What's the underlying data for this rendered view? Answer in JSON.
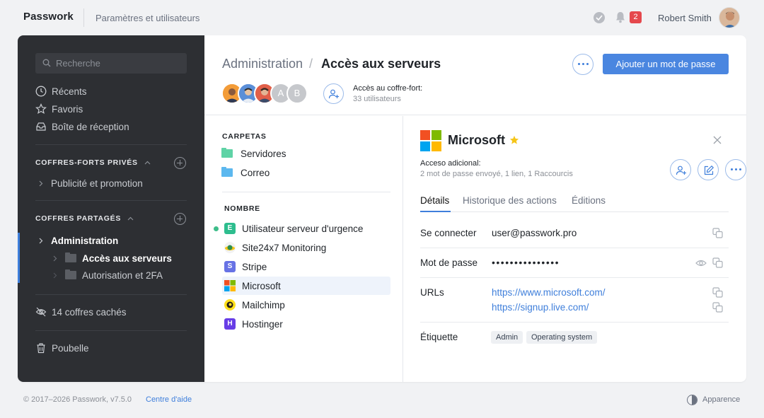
{
  "app": {
    "logo": "Passwork",
    "section": "Paramètres et utilisateurs",
    "notification_count": "2",
    "user_name": "Robert Smith"
  },
  "sidebar": {
    "search_placeholder": "Recherche",
    "nav": [
      {
        "label": "Récents",
        "icon": "clock-icon"
      },
      {
        "label": "Favoris",
        "icon": "star-icon"
      },
      {
        "label": "Boîte de réception",
        "icon": "inbox-icon"
      }
    ],
    "private_vaults": {
      "title": "COFFRES-FORTS PRIVÉS",
      "items": [
        {
          "label": "Publicité et promotion"
        }
      ]
    },
    "shared_vaults": {
      "title": "COFFRES PARTAGÉS",
      "items": [
        {
          "label": "Administration",
          "children": [
            {
              "label": "Accès aux serveurs"
            },
            {
              "label": "Autorisation et 2FA"
            }
          ]
        }
      ]
    },
    "hidden_vaults": "14 coffres cachés",
    "trash": "Poubelle"
  },
  "header": {
    "breadcrumb_parent": "Administration",
    "breadcrumb_separator": "/",
    "breadcrumb_current": "Accès aux serveurs",
    "add_password_button": "Ajouter un mot de passe",
    "member_letters": [
      "A",
      "B"
    ],
    "access_title": "Accès au coffre-fort:",
    "access_count": "33 utilisateurs"
  },
  "middle": {
    "folders_heading": "CARPETAS",
    "folders": [
      {
        "label": "Servidores",
        "color": "#5fd3a6"
      },
      {
        "label": "Correo",
        "color": "#5cb8ef"
      }
    ],
    "names_heading": "NOMBRE",
    "entries": [
      {
        "label": "Utilisateur serveur d'urgence",
        "icon_letter": "E",
        "color": "#2dbd8e"
      },
      {
        "label": "Site24x7 Monitoring",
        "icon_letter": "",
        "color": "#f2f2f2"
      },
      {
        "label": "Stripe",
        "icon_letter": "S",
        "color": "#6772e5"
      },
      {
        "label": "Microsoft",
        "icon_letter": "",
        "color": "#ffffff"
      },
      {
        "label": "Mailchimp",
        "icon_letter": "",
        "color": "#ffe01b"
      },
      {
        "label": "Hostinger",
        "icon_letter": "H",
        "color": "#673de6"
      }
    ],
    "selected_entry": "Microsoft"
  },
  "detail": {
    "title": "Microsoft",
    "access_title": "Acceso adicional:",
    "access_sub": "2 mot de passe envoyé, 1 lien, 1 Raccourcis",
    "tabs": [
      "Détails",
      "Historique des actions",
      "Éditions"
    ],
    "active_tab": "Détails",
    "fields": {
      "login_label": "Se connecter",
      "login_value": "user@passwork.pro",
      "password_label": "Mot de passe",
      "password_value": "•••••••••••••••",
      "urls_label": "URLs",
      "urls": [
        "https://www.microsoft.com/",
        "https://signup.live.com/"
      ],
      "tags_label": "Étiquette",
      "tags": [
        "Admin",
        "Operating system"
      ]
    },
    "accent_color": "#3f7fdb",
    "star_color": "#f5c518"
  },
  "footer": {
    "copyright": "© 2017–2026 Passwork, v7.5.0",
    "help_link": "Centre d'aide",
    "appearance": "Apparence"
  }
}
